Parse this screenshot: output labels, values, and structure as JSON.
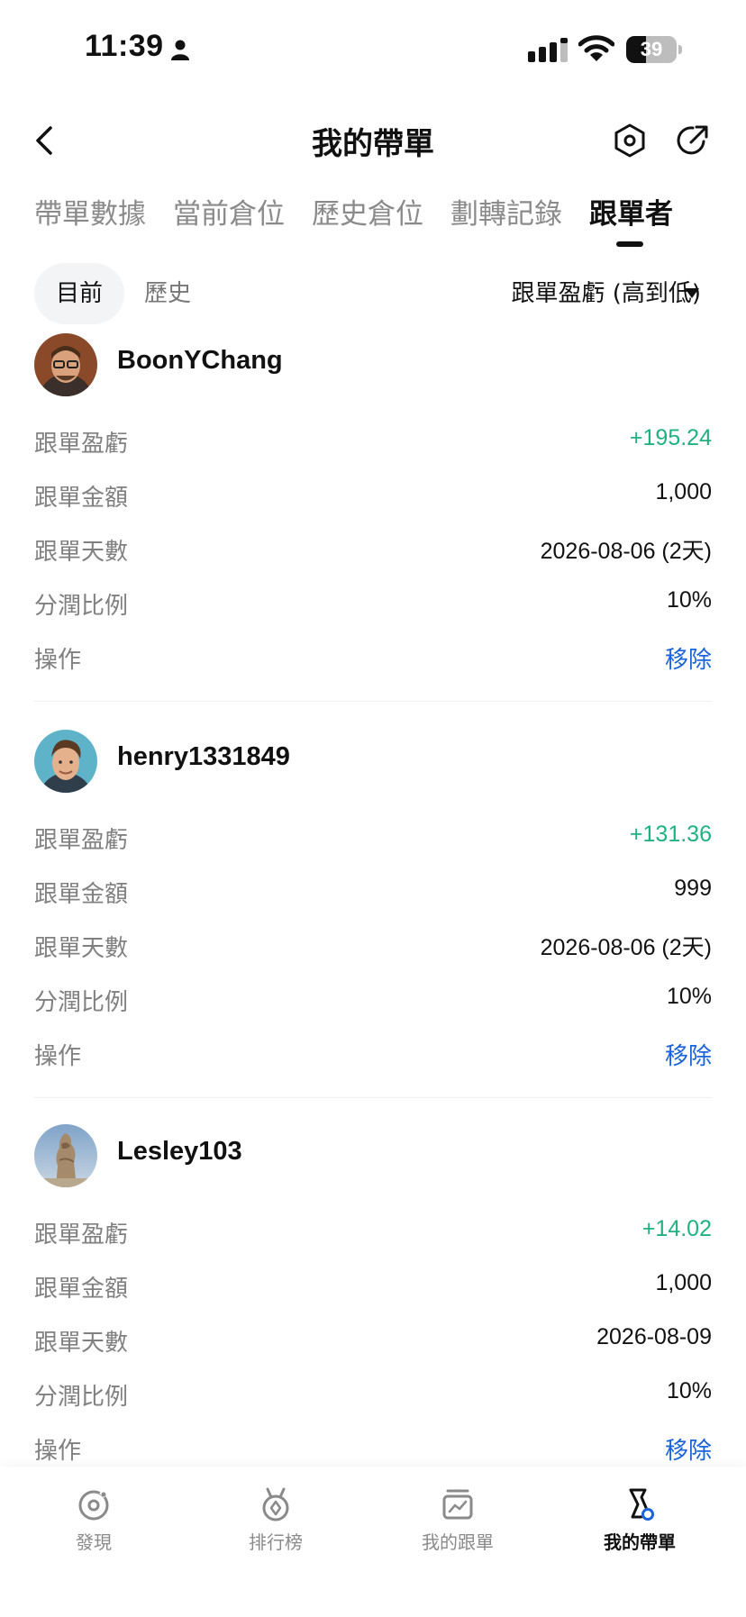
{
  "status_bar": {
    "time": "11:39",
    "battery": "39",
    "battery_level": 0.39
  },
  "header": {
    "title": "我的帶單",
    "icons": [
      "back-icon",
      "settings-hexagon-icon",
      "share-icon"
    ]
  },
  "tabs": [
    {
      "label": "帶單數據",
      "active": false
    },
    {
      "label": "當前倉位",
      "active": false
    },
    {
      "label": "歷史倉位",
      "active": false
    },
    {
      "label": "劃轉記錄",
      "active": false
    },
    {
      "label": "跟單者",
      "active": true
    }
  ],
  "filter": {
    "current_label": "目前",
    "history_label": "歷史",
    "sort_label": "跟單盈虧 (高到低)"
  },
  "colors": {
    "positive": "#1fb27f",
    "action": "#1b63d9"
  },
  "followers": [
    {
      "username": "BoonYChang",
      "rows": [
        {
          "label": "跟單盈虧",
          "value": "+195.24"
        },
        {
          "label": "跟單金額",
          "value": "1,000"
        },
        {
          "label": "跟單天數",
          "value": "2026-08-06 (2天)"
        },
        {
          "label": "分潤比例",
          "value": "10%"
        },
        {
          "label": "操作",
          "value": "移除"
        }
      ]
    },
    {
      "username": "henry1331849",
      "rows": [
        {
          "label": "跟單盈虧",
          "value": "+131.36"
        },
        {
          "label": "跟單金額",
          "value": "999"
        },
        {
          "label": "跟單天數",
          "value": "2026-08-06 (2天)"
        },
        {
          "label": "分潤比例",
          "value": "10%"
        },
        {
          "label": "操作",
          "value": "移除"
        }
      ]
    },
    {
      "username": "Lesley103",
      "rows": [
        {
          "label": "跟單盈虧",
          "value": "+14.02"
        },
        {
          "label": "跟單金額",
          "value": "1,000"
        },
        {
          "label": "跟單天數",
          "value": "2026-08-09"
        },
        {
          "label": "分潤比例",
          "value": "10%"
        },
        {
          "label": "操作",
          "value": "移除"
        }
      ]
    }
  ],
  "bottom_nav": [
    {
      "label": "發現",
      "icon": "discover-icon",
      "active": false
    },
    {
      "label": "排行榜",
      "icon": "ranking-medal-icon",
      "active": false
    },
    {
      "label": "我的跟單",
      "icon": "my-copy-chart-icon",
      "active": false
    },
    {
      "label": "我的帶單",
      "icon": "my-lead-icon",
      "active": true
    }
  ]
}
